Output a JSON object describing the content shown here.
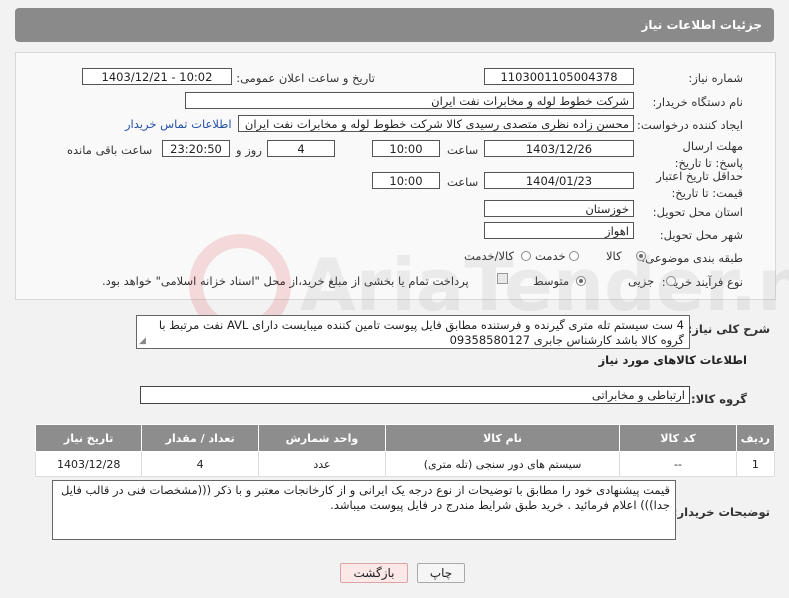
{
  "header": {
    "title": "جزئیات اطلاعات نیاز"
  },
  "form": {
    "need_number_label": "شماره نیاز:",
    "need_number": "1103001105004378",
    "announce_label": "تاریخ و ساعت اعلان عمومی:",
    "announce_value": "1403/12/21 - 10:02",
    "buyer_org_label": "نام دستگاه خریدار:",
    "buyer_org": "شرکت خطوط لوله و مخابرات نفت ایران",
    "requester_label": "ایجاد کننده درخواست:",
    "requester": "محسن زاده نظری متصدی رسیدی کالا شرکت خطوط لوله و مخابرات نفت ایران",
    "contact_link": "اطلاعات تماس خریدار",
    "deadline_label": "مهلت ارسال پاسخ: تا تاریخ:",
    "deadline_date": "1403/12/26",
    "time_label": "ساعت",
    "deadline_time": "10:00",
    "days_value": "4",
    "days_label": "روز و",
    "remaining_time": "23:20:50",
    "remaining_label": "ساعت باقی مانده",
    "min_validity_label": "حداقل تاریخ اعتبار قیمت: تا تاریخ:",
    "validity_date": "1404/01/23",
    "validity_time": "10:00",
    "province_label": "استان محل تحویل:",
    "province": "خوزستان",
    "city_label": "شهر محل تحویل:",
    "city": "اهواز",
    "category_label": "طبقه بندی موضوعی:",
    "category_options": [
      "کالا",
      "خدمت",
      "کالا/خدمت"
    ],
    "process_label": "نوع فرآیند خرید :",
    "process_options": [
      "جزیی",
      "متوسط"
    ],
    "payment_note": "پرداخت تمام یا بخشی از مبلغ خرید،از محل \"اسناد خزانه اسلامی\" خواهد بود."
  },
  "summary": {
    "label": "شرح کلی نیاز:",
    "text": "4 ست سیستم تله متری گیرنده و فرستنده مطابق فایل پیوست تامین کننده میبایست دارای AVL نفت مرتبط با گروه کالا باشد کارشناس جابری 09358580127"
  },
  "goods": {
    "section_title": "اطلاعات کالاهای مورد نیاز",
    "group_label": "گروه کالا:",
    "group_value": "ارتباطی و مخابراتی",
    "columns": [
      "ردیف",
      "کد کالا",
      "نام کالا",
      "واحد شمارش",
      "تعداد / مقدار",
      "تاریخ نیاز"
    ],
    "rows": [
      [
        "1",
        "--",
        "سیستم های دور سنجی (تله متری)",
        "عدد",
        "4",
        "1403/12/28"
      ]
    ]
  },
  "buyer_notes": {
    "label": "توضیحات خریدار:",
    "text": "قیمت پیشنهادی خود را مطابق با توضیحات از نوع درجه یک ایرانی و از کارخانجات معتبر و با ذکر (((مشخصات فنی در قالب فایل جدا))) اعلام فرمائید . خرید طبق شرایط مندرج در فایل پیوست میباشد."
  },
  "buttons": {
    "print": "چاپ",
    "back": "بازگشت"
  },
  "watermark": {
    "text": "AriaTender.net"
  }
}
